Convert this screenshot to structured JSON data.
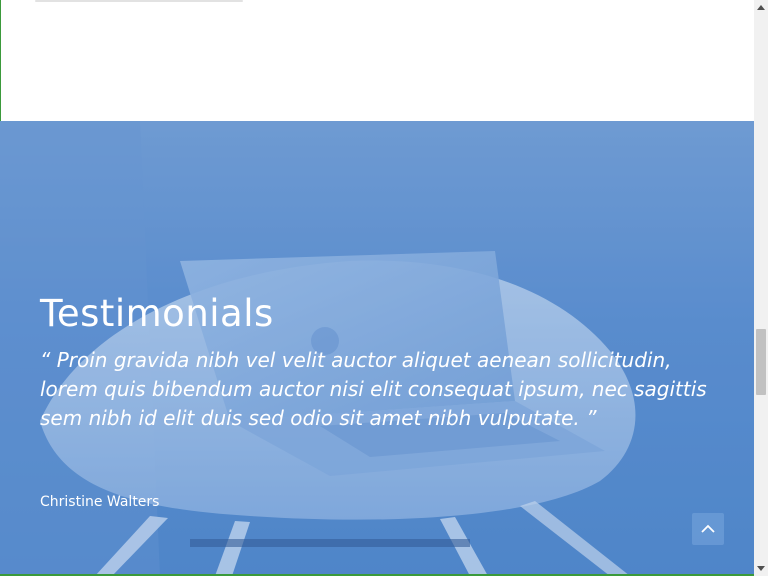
{
  "testimonials": {
    "title": "Testimonials",
    "quote": "“ Proin gravida nibh vel velit auctor aliquet aenean sollicitudin, lorem quis bibendum auctor nisi elit consequat ipsum, nec sagittis sem nibh id elit duis sed odio sit amet nibh vulputate. ”",
    "author": "Christine Walters"
  },
  "icons": {
    "back_to_top": "chevron-up-icon",
    "scroll_up": "triangle-up-icon",
    "scroll_down": "triangle-down-icon"
  },
  "colors": {
    "accent_green": "#3b9a3b",
    "overlay_blue": "#5d8fcf"
  }
}
